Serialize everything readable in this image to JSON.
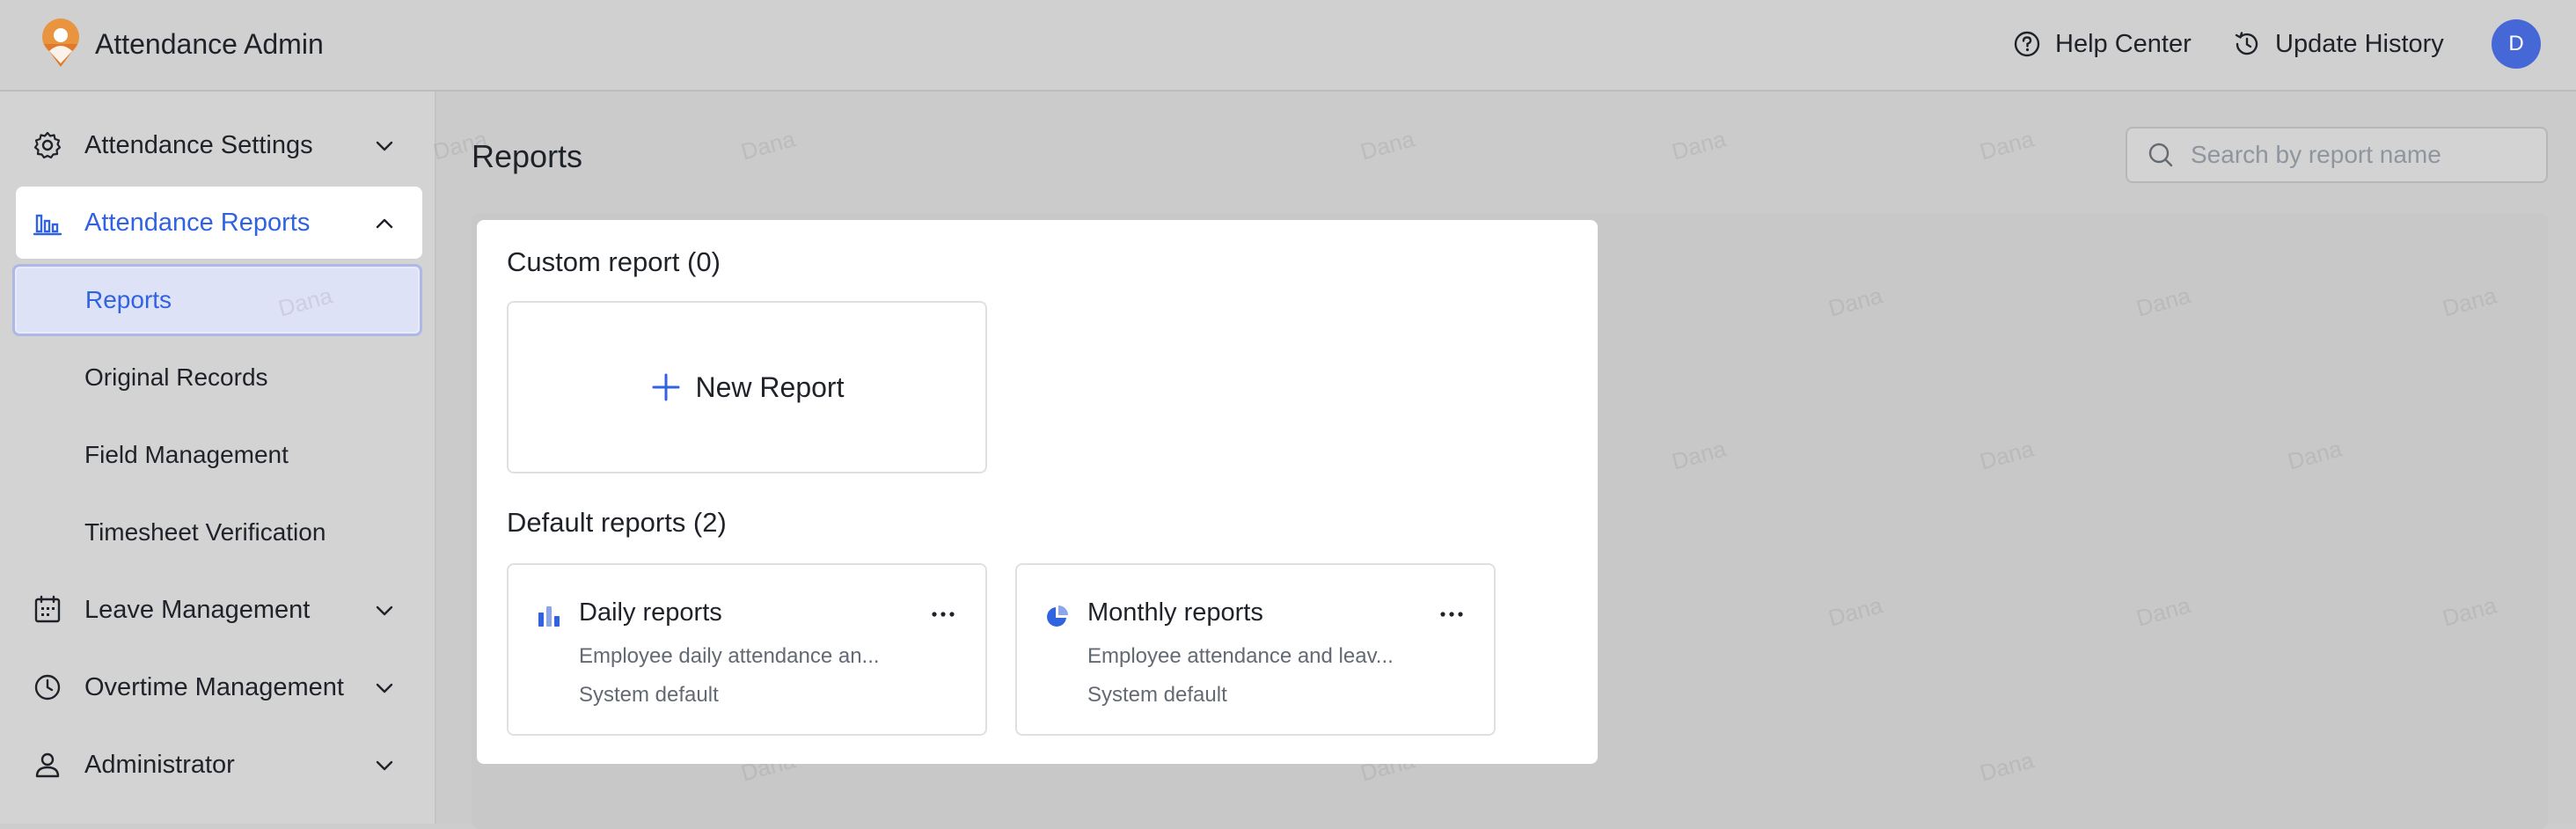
{
  "header": {
    "app_title": "Attendance Admin",
    "help_label": "Help Center",
    "history_label": "Update History",
    "avatar_initial": "D"
  },
  "sidebar": {
    "items": [
      {
        "label": "Attendance Settings",
        "icon": "gear-icon"
      },
      {
        "label": "Attendance Reports",
        "icon": "bar-chart-icon"
      },
      {
        "label": "Leave Management",
        "icon": "calendar-icon"
      },
      {
        "label": "Overtime Management",
        "icon": "clock-icon"
      },
      {
        "label": "Administrator",
        "icon": "user-icon"
      }
    ],
    "report_subitems": [
      {
        "label": "Reports"
      },
      {
        "label": "Original Records"
      },
      {
        "label": "Field Management"
      },
      {
        "label": "Timesheet Verification"
      }
    ]
  },
  "main": {
    "page_title": "Reports",
    "search_placeholder": "Search by report name",
    "custom_section_title": "Custom report (0)",
    "new_report_label": "New Report",
    "default_section_title": "Default reports (2)",
    "default_reports": [
      {
        "title": "Daily reports",
        "description": "Employee daily attendance an...",
        "meta": "System default",
        "icon": "bar-chart-icon"
      },
      {
        "title": "Monthly reports",
        "description": "Employee attendance and leav...",
        "meta": "System default",
        "icon": "pie-chart-icon"
      }
    ]
  },
  "watermark_text": "Dana",
  "colors": {
    "accent": "#3162e0",
    "avatar": "#4568d6",
    "logo": "#e07a2b"
  }
}
